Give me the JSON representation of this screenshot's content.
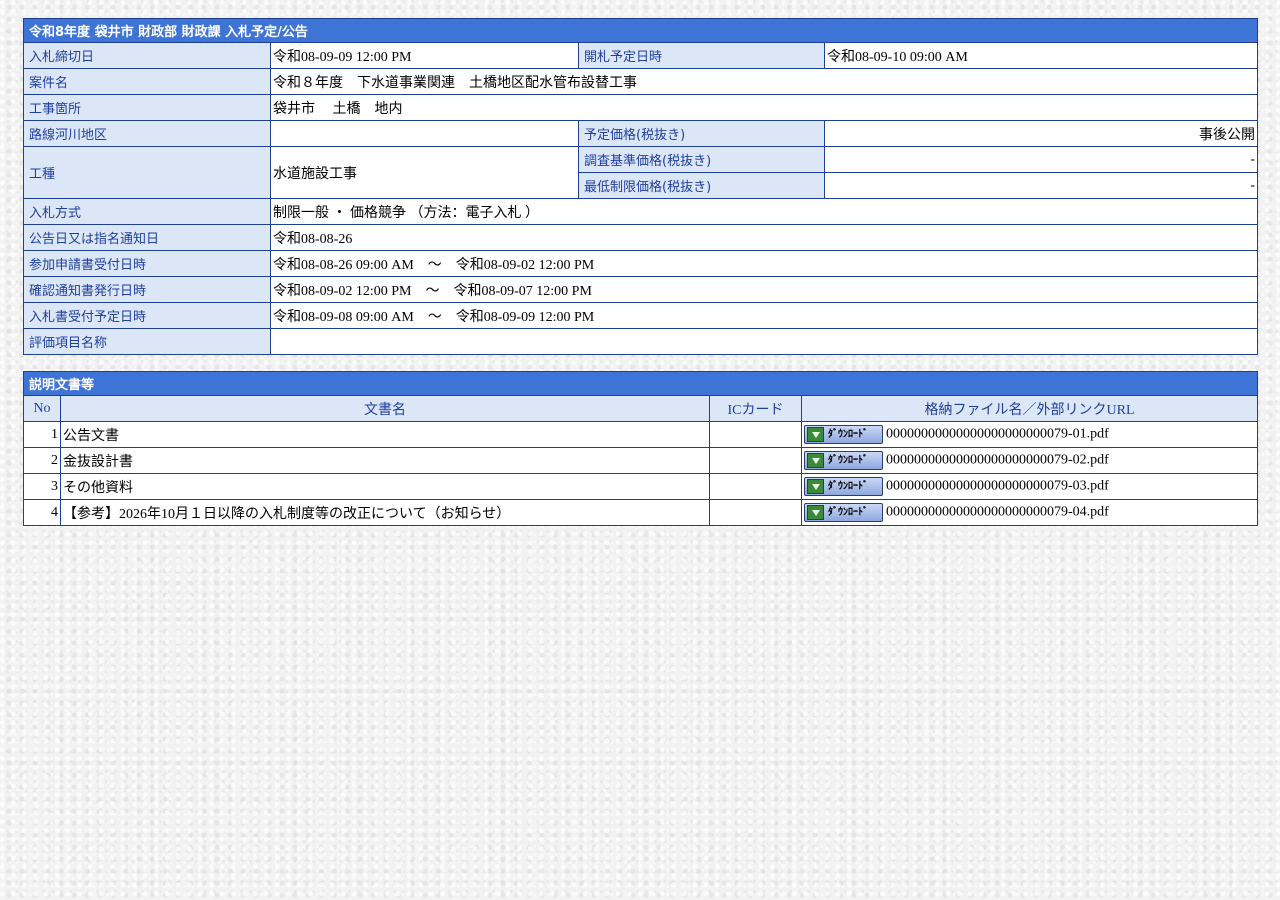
{
  "info": {
    "title": "令和8年度 袋井市 財政部 財政課 入札予定/公告",
    "rows": {
      "deadline_label": "入札締切日",
      "deadline_value": "令和08-09-09 12:00 PM",
      "opening_label": "開札予定日時",
      "opening_value": "令和08-09-10 09:00 AM",
      "case_label": "案件名",
      "case_value": "令和８年度　下水道事業関連　土橋地区配水管布設替工事",
      "site_label": "工事箇所",
      "site_value": "袋井市　 土橋　地内",
      "route_label": "路線河川地区",
      "route_value": "",
      "planned_price_label": "予定価格(税抜き)",
      "planned_price_value": "事後公開",
      "work_type_label": "工種",
      "work_type_value": "水道施設工事",
      "survey_price_label": "調査基準価格(税抜き)",
      "survey_price_value": "-",
      "min_price_label": "最低制限価格(税抜き)",
      "min_price_value": "-",
      "method_label": "入札方式",
      "method_value": "制限一般 ・ 価格競争 （方法：電子入札 ）",
      "notice_label": "公告日又は指名通知日",
      "notice_value": "令和08-08-26",
      "apply_label": "参加申請書受付日時",
      "apply_value": "令和08-08-26 09:00 AM　～　令和08-09-02 12:00 PM",
      "confirm_label": "確認通知書発行日時",
      "confirm_value": "令和08-09-02 12:00 PM　～　令和08-09-07 12:00 PM",
      "bid_recv_label": "入札書受付予定日時",
      "bid_recv_value": "令和08-09-08 09:00 AM　～　令和08-09-09 12:00 PM",
      "eval_label": "評価項目名称",
      "eval_value": ""
    }
  },
  "docs": {
    "title": "説明文書等",
    "headers": {
      "no": "No",
      "name": "文書名",
      "ic": "ICカード",
      "file": "格納ファイル名／外部リンクURL"
    },
    "download_label": "ﾀﾞｳﾝﾛｰﾄﾞ",
    "items": [
      {
        "no": "1",
        "name": "公告文書",
        "ic": "",
        "file": "00000000000000000000000079-01.pdf"
      },
      {
        "no": "2",
        "name": "金抜設計書",
        "ic": "",
        "file": "00000000000000000000000079-02.pdf"
      },
      {
        "no": "3",
        "name": "その他資料",
        "ic": "",
        "file": "00000000000000000000000079-03.pdf"
      },
      {
        "no": "4",
        "name": "【参考】2026年10月１日以降の入札制度等の改正について（お知らせ）",
        "ic": "",
        "file": "00000000000000000000000079-04.pdf"
      }
    ]
  }
}
